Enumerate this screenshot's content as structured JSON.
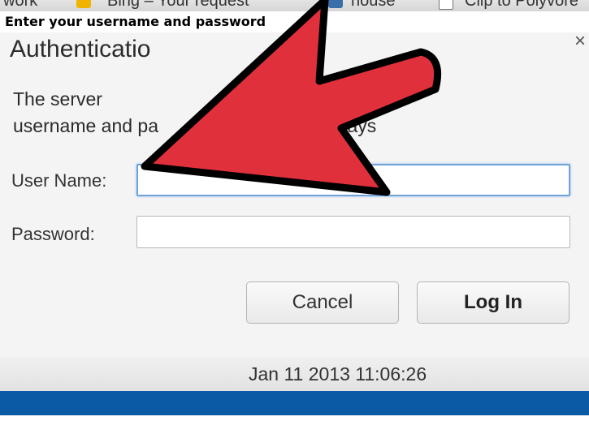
{
  "bookmarks": {
    "items": [
      {
        "label": "work"
      },
      {
        "label": "Bing – Your request"
      },
      {
        "label": "house"
      },
      {
        "label": "Clip to Polyvore"
      }
    ]
  },
  "caption": "Enter your username and password",
  "dialog": {
    "title": "Authenticatio",
    "message_line1": "The server",
    "message_line2": "username and pa",
    "message_tail": "says",
    "close_glyph": "×",
    "username_label": "User Name:",
    "username_value": "",
    "password_label": "Password:",
    "password_value": "",
    "cancel_label": "Cancel",
    "login_label": "Log In"
  },
  "footer": {
    "timestamp": "Jan 11 2013 11:06:26"
  },
  "colors": {
    "arrow": "#e0303c",
    "footer_bar": "#0b5aa6",
    "focus_ring": "#6fa3d8"
  }
}
